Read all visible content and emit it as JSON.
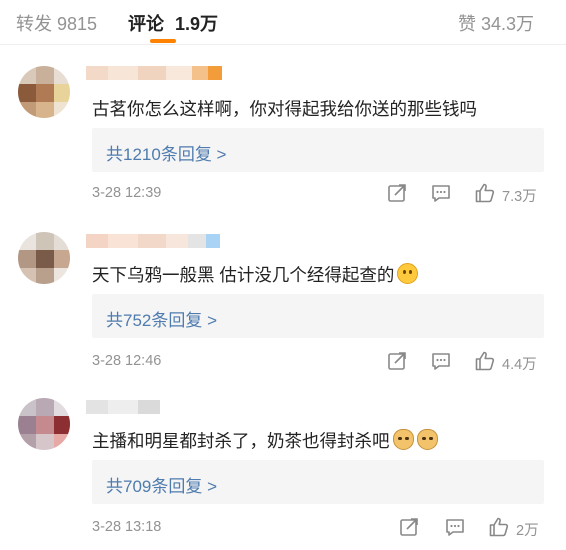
{
  "tabs": {
    "repost": "转发 9815",
    "comments_label": "评论",
    "comments_count": "1.9万",
    "likes": "赞 34.3万"
  },
  "comments": [
    {
      "text": "古茗你怎么这样啊，你对得起我给你送的那些钱吗",
      "replies": "共1210条回复 >",
      "time": "3-28 12:39",
      "likes": "7.3万"
    },
    {
      "text": "天下乌鸦一般黑 估计没几个经得起查的",
      "replies": "共752条回复 >",
      "time": "3-28 12:46",
      "likes": "4.4万"
    },
    {
      "text": "主播和明星都封杀了，奶茶也得封杀吧",
      "replies": "共709条回复 >",
      "time": "3-28 13:18",
      "likes": "2万"
    }
  ],
  "icons": {
    "repost": "share-icon",
    "comment": "comment-icon",
    "like": "thumbs-up-icon",
    "emoji_grimace": "grimace-emoji-icon",
    "emoji_doge": "doge-emoji-icon"
  },
  "colors": {
    "accent": "#ff8200",
    "link": "#4f7cae",
    "muted": "#939393"
  }
}
